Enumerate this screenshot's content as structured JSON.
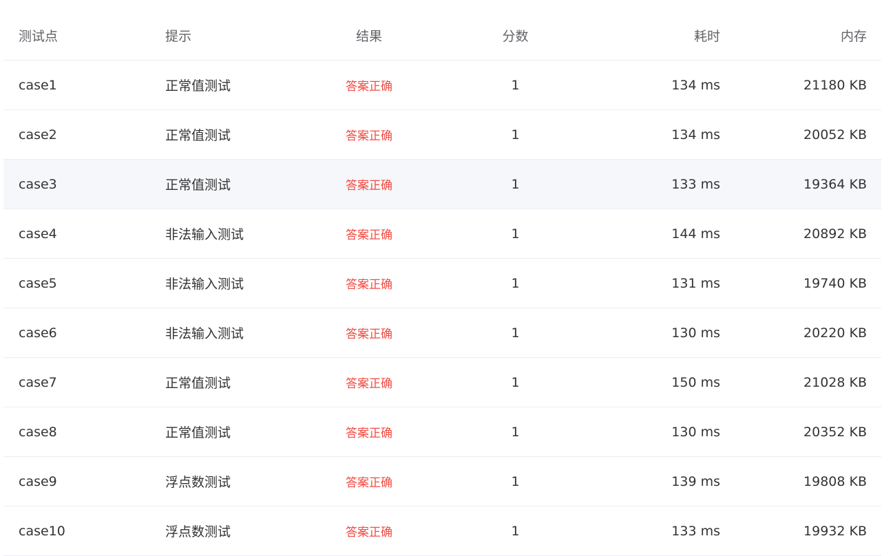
{
  "colors": {
    "accepted": "#f24a40",
    "header_text": "#606266",
    "body_text": "#333333",
    "row_divider": "#ebeef5",
    "hover_row_bg": "#f5f7fa"
  },
  "table": {
    "columns": [
      "测试点",
      "提示",
      "结果",
      "分数",
      "耗时",
      "内存"
    ],
    "rows": [
      {
        "case": "case1",
        "hint": "正常值测试",
        "result": "答案正确",
        "score": "1",
        "time": "134 ms",
        "memory": "21180 KB"
      },
      {
        "case": "case2",
        "hint": "正常值测试",
        "result": "答案正确",
        "score": "1",
        "time": "134 ms",
        "memory": "20052 KB"
      },
      {
        "case": "case3",
        "hint": "正常值测试",
        "result": "答案正确",
        "score": "1",
        "time": "133 ms",
        "memory": "19364 KB"
      },
      {
        "case": "case4",
        "hint": "非法输入测试",
        "result": "答案正确",
        "score": "1",
        "time": "144 ms",
        "memory": "20892 KB"
      },
      {
        "case": "case5",
        "hint": "非法输入测试",
        "result": "答案正确",
        "score": "1",
        "time": "131 ms",
        "memory": "19740 KB"
      },
      {
        "case": "case6",
        "hint": "非法输入测试",
        "result": "答案正确",
        "score": "1",
        "time": "130 ms",
        "memory": "20220 KB"
      },
      {
        "case": "case7",
        "hint": "正常值测试",
        "result": "答案正确",
        "score": "1",
        "time": "150 ms",
        "memory": "21028 KB"
      },
      {
        "case": "case8",
        "hint": "正常值测试",
        "result": "答案正确",
        "score": "1",
        "time": "130 ms",
        "memory": "20352 KB"
      },
      {
        "case": "case9",
        "hint": "浮点数测试",
        "result": "答案正确",
        "score": "1",
        "time": "139 ms",
        "memory": "19808 KB"
      },
      {
        "case": "case10",
        "hint": "浮点数测试",
        "result": "答案正确",
        "score": "1",
        "time": "133 ms",
        "memory": "19932 KB"
      }
    ]
  }
}
